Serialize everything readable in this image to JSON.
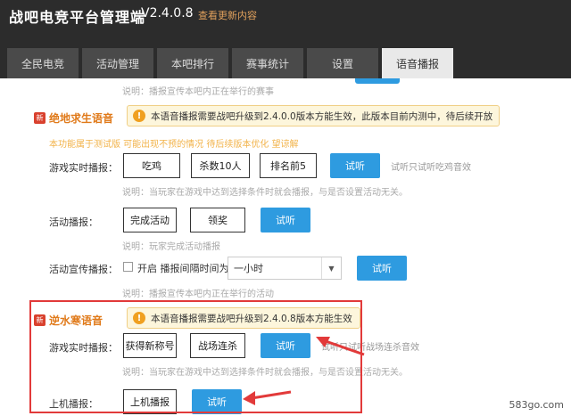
{
  "app": {
    "title": "战吧电竞平台管理端",
    "version": "V2.4.0.8",
    "update_link": "查看更新内容"
  },
  "tabs": [
    {
      "label": "全民电竞",
      "active": false
    },
    {
      "label": "活动管理",
      "active": false
    },
    {
      "label": "本吧排行",
      "active": false
    },
    {
      "label": "赛事统计",
      "active": false
    },
    {
      "label": "设置",
      "active": false
    },
    {
      "label": "语音播报",
      "active": true
    }
  ],
  "top_note": "说明：播报宣传本吧内正在举行的赛事",
  "pubg": {
    "badge": "新",
    "title": "绝地求生语音",
    "warning": "本语音播报需要战吧升级到2.4.0.0版本方能生效，此版本目前内测中，待后续开放",
    "beta_note": "本功能属于测试版 可能出现不预的情况 待后续版本优化 望谅解",
    "realtime_label": "游戏实时播报：",
    "realtime_fields": [
      "吃鸡",
      "杀数10人",
      "排名前5"
    ],
    "realtime_button": "试听",
    "realtime_hint": "试听只试听吃鸡音效",
    "realtime_note": "说明：当玩家在游戏中达到选择条件时就会播报，与是否设置活动无关。",
    "activity_label": "活动播报：",
    "activity_fields": [
      "完成活动",
      "领奖"
    ],
    "activity_button": "试听",
    "activity_note": "说明：玩家完成活动播报",
    "promo_label": "活动宣传播报：",
    "promo_checkbox_label": "开启 播报间隔时间为",
    "promo_select_value": "一小时",
    "promo_button": "试听",
    "promo_note": "说明：播报宣传本吧内正在举行的活动"
  },
  "nishuihan": {
    "badge": "新",
    "title": "逆水寒语音",
    "warning": "本语音播报需要战吧升级到2.4.0.8版本方能生效",
    "realtime_label": "游戏实时播报：",
    "realtime_fields": [
      "获得新称号",
      "战场连杀"
    ],
    "realtime_button": "试听",
    "realtime_hint": "试听只试听战场连杀音效",
    "realtime_note": "说明：当玩家在游戏中达到选择条件时就会播报，与是否设置活动无关。",
    "online_label": "上机播报：",
    "online_field": "上机播报",
    "online_button": "试听"
  },
  "watermark": "583go.com",
  "colors": {
    "accent": "#2e9be0",
    "highlight": "#e23a3a",
    "section_title": "#e07a1a",
    "warning_bg": "#fdf6dc"
  }
}
